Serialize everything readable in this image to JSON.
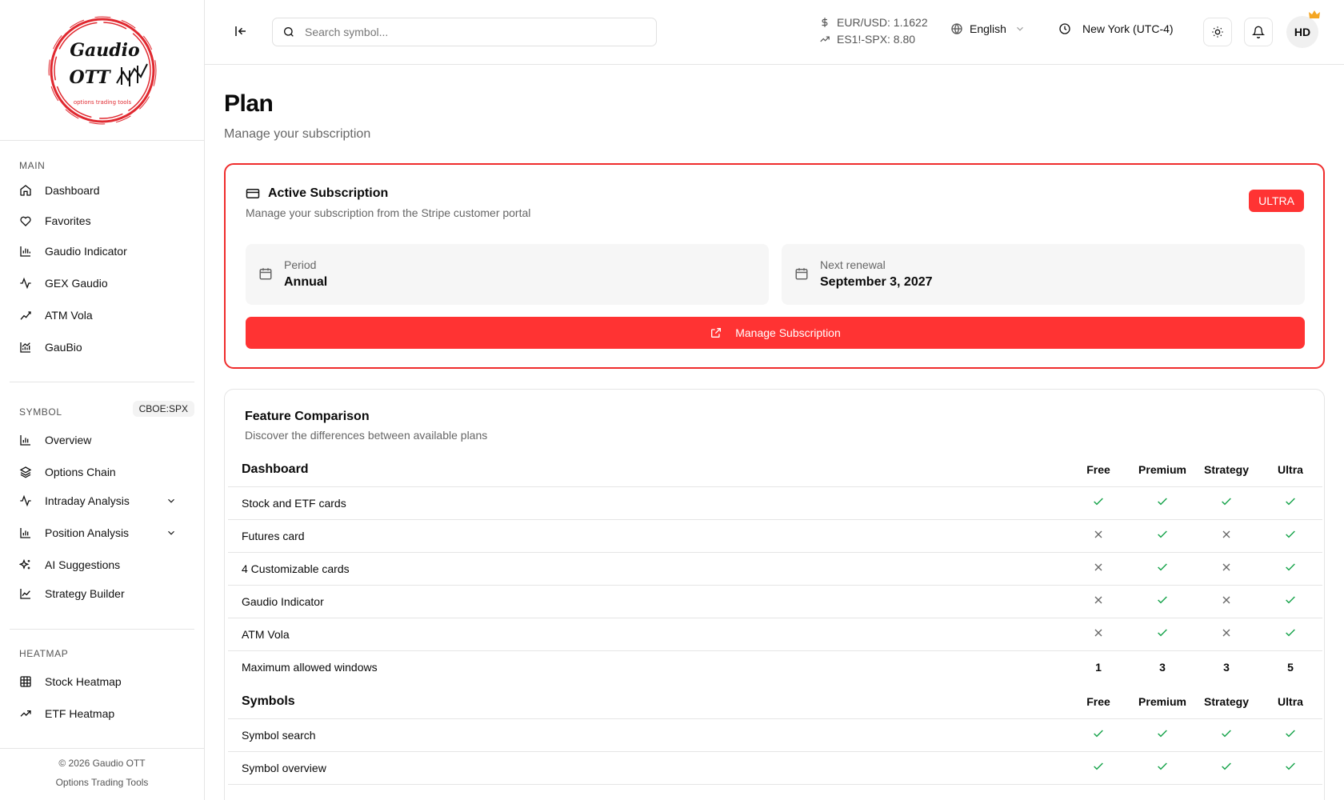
{
  "brand": {
    "logo_line1": "Gaudio",
    "logo_line2": "OTT",
    "logo_tagline": "options trading tools",
    "accent_color": "#ff3333"
  },
  "sidebar": {
    "main_label": "MAIN",
    "main_items": [
      {
        "label": "Dashboard",
        "icon": "home-icon"
      },
      {
        "label": "Favorites",
        "icon": "heart-icon"
      },
      {
        "label": "Gaudio Indicator",
        "icon": "bar-chart-icon"
      },
      {
        "label": "GEX Gaudio",
        "icon": "activity-icon"
      },
      {
        "label": "ATM Vola",
        "icon": "chart-network-icon"
      },
      {
        "label": "GauBio",
        "icon": "chart-area-icon"
      }
    ],
    "symbol_label": "SYMBOL",
    "symbol_badge": "CBOE:SPX",
    "symbol_items": [
      {
        "label": "Overview",
        "icon": "bar-chart-icon"
      },
      {
        "label": "Options Chain",
        "icon": "layers-icon"
      },
      {
        "label": "Intraday Analysis",
        "icon": "activity-icon"
      },
      {
        "label": "Position Analysis",
        "icon": "bar-chart-icon"
      },
      {
        "label": "AI Suggestions",
        "icon": "sparkles-icon"
      },
      {
        "label": "Strategy Builder",
        "icon": "line-chart-icon"
      }
    ],
    "heatmap_label": "HEATMAP",
    "heatmap_items": [
      {
        "label": "Stock Heatmap",
        "icon": "grid-icon"
      },
      {
        "label": "ETF Heatmap",
        "icon": "trending-up-icon"
      }
    ],
    "footer_line1": "© 2026 Gaudio OTT",
    "footer_line2": "Options Trading Tools"
  },
  "header": {
    "search_placeholder": "Search symbol...",
    "ticker1": "EUR/USD: 1.1622",
    "ticker2": "ES1!-SPX: 8.80",
    "language": "English",
    "timezone": "New York (UTC-4)",
    "avatar_initials": "HD"
  },
  "page": {
    "title": "Plan",
    "subtitle": "Manage your subscription"
  },
  "subscription": {
    "title": "Active Subscription",
    "subtitle": "Manage your subscription from the Stripe customer portal",
    "plan_badge": "ULTRA",
    "period_label": "Period",
    "period_value": "Annual",
    "renewal_label": "Next renewal",
    "renewal_value": "September 3, 2027",
    "manage_label": "Manage Subscription"
  },
  "comparison": {
    "title": "Feature Comparison",
    "subtitle": "Discover the differences between available plans",
    "plans": [
      "Free",
      "Premium",
      "Strategy",
      "Ultra"
    ],
    "sections": [
      {
        "name": "Dashboard",
        "rows": [
          {
            "feature": "Stock and ETF cards",
            "values": [
              "check",
              "check",
              "check",
              "check"
            ]
          },
          {
            "feature": "Futures card",
            "values": [
              "cross",
              "check",
              "cross",
              "check"
            ]
          },
          {
            "feature": "4 Customizable cards",
            "values": [
              "cross",
              "check",
              "cross",
              "check"
            ]
          },
          {
            "feature": "Gaudio Indicator",
            "values": [
              "cross",
              "check",
              "cross",
              "check"
            ]
          },
          {
            "feature": "ATM Vola",
            "values": [
              "cross",
              "check",
              "cross",
              "check"
            ]
          },
          {
            "feature": "Maximum allowed windows",
            "values": [
              "1",
              "3",
              "3",
              "5"
            ]
          }
        ]
      },
      {
        "name": "Symbols",
        "rows": [
          {
            "feature": "Symbol search",
            "values": [
              "check",
              "check",
              "check",
              "check"
            ]
          },
          {
            "feature": "Symbol overview",
            "values": [
              "check",
              "check",
              "check",
              "check"
            ]
          }
        ]
      }
    ],
    "check_color": "#16a34a",
    "cross_color": "#666666"
  }
}
